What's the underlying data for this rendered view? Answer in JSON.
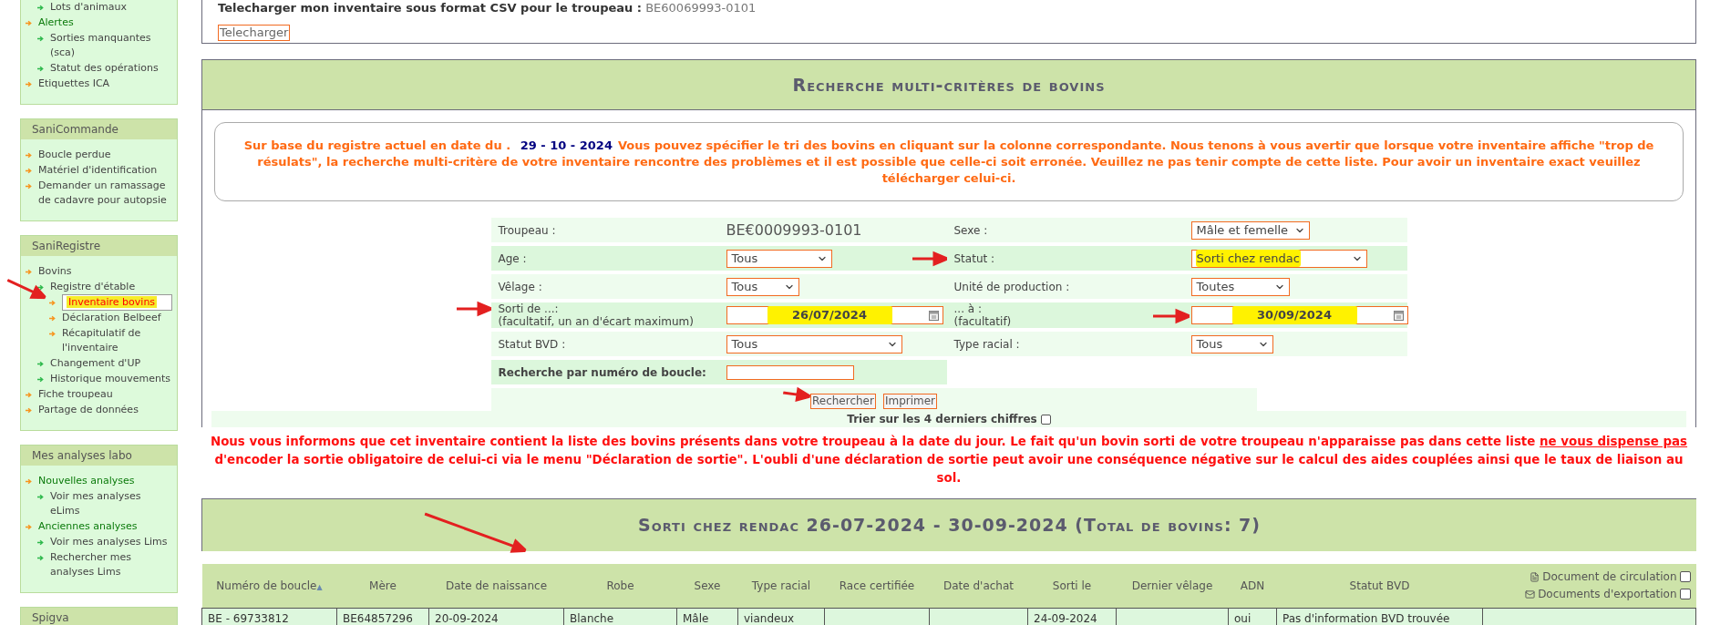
{
  "sidebar": {
    "sections": [
      {
        "items_continued": [
          {
            "label": "Lots d'animaux",
            "selected": false
          }
        ],
        "items": [
          {
            "label": "Alertes",
            "kind": "group",
            "selected": false,
            "children": [
              {
                "label": "Sorties manquantes (sca)",
                "selected": false
              },
              {
                "label": "Statut des opérations",
                "selected": false
              }
            ]
          },
          {
            "label": "Etiquettes ICA",
            "selected": false
          }
        ]
      },
      {
        "title": "SaniCommande",
        "items": [
          {
            "label": "Boucle perdue",
            "selected": false
          },
          {
            "label": "Matériel d'identification",
            "selected": false
          },
          {
            "label": "Demander un ramassage de cadavre pour autopsie",
            "selected": false
          }
        ]
      },
      {
        "title": "SaniRegistre",
        "items": [
          {
            "label": "Bovins",
            "selected": false,
            "children": [
              {
                "label": "Registre d'étable",
                "selected": false,
                "children": [
                  {
                    "label": "Inventaire bovins",
                    "selected": true
                  },
                  {
                    "label": "Déclaration Belbeef",
                    "selected": false
                  },
                  {
                    "label": "Récapitulatif de l'inventaire",
                    "selected": false
                  }
                ]
              },
              {
                "label": "Changement d'UP",
                "selected": false
              },
              {
                "label": "Historique mouvements",
                "selected": false
              }
            ]
          },
          {
            "label": "Fiche troupeau",
            "selected": false
          },
          {
            "label": "Partage de données",
            "selected": false
          }
        ]
      },
      {
        "title": "Mes analyses labo",
        "items": [
          {
            "label": "Nouvelles analyses",
            "kind": "group",
            "selected": false,
            "children": [
              {
                "label": "Voir mes analyses eLims",
                "selected": false
              }
            ]
          },
          {
            "label": "Anciennes analyses",
            "kind": "group",
            "selected": false,
            "children": [
              {
                "label": "Voir mes analyses Lims",
                "selected": false
              },
              {
                "label": "Rechercher mes analyses Lims",
                "selected": false
              }
            ]
          }
        ]
      },
      {
        "title": "Spigva"
      }
    ]
  },
  "export": {
    "label": "Telecharger mon inventaire sous format CSV pour le troupeau :",
    "herd": "BE60069993-0101",
    "button": "Telecharger"
  },
  "search": {
    "title": "Recherche multi-critères de bovins",
    "notice": {
      "prefix": "Sur base du registre actuel en date du .",
      "date": "29 - 10 - 2024",
      "text": "Vous pouvez spécifier le tri des bovins en cliquant sur la colonne correspondante. Nous tenons à vous avertir que lorsque votre inventaire affiche \"trop de résulats\", la recherche multi-critère de votre inventaire rencontre des problèmes et il est possible que celle-ci soit erronée. Veuillez ne pas tenir compte de cette liste. Pour avoir un inventaire exact veuillez télécharger celui-ci."
    },
    "rows": [
      [
        {
          "label": "Troupeau :",
          "kind": "text",
          "value": "BE€0009993-0101"
        },
        {
          "label": "Sexe :",
          "kind": "select",
          "value": "Mâle et femelle",
          "highlighted": false
        }
      ],
      [
        {
          "label": "Age :",
          "kind": "select",
          "value": "Tous",
          "highlighted": false
        },
        {
          "label": "Statut :",
          "kind": "select",
          "value": "Sorti chez rendac",
          "highlighted": true,
          "label_arrow": true
        }
      ],
      [
        {
          "label": "Vêlage :",
          "kind": "select",
          "value": "Tous",
          "highlighted": false
        },
        {
          "label": "Unité de production :",
          "kind": "select",
          "value": "Toutes",
          "highlighted": false
        }
      ],
      [
        {
          "label": "Sorti de ...:",
          "note": "(facultatif, un an d'écart maximum)",
          "kind": "date",
          "value": "26/07/2024",
          "highlighted": true,
          "label_arrow": true
        },
        {
          "label": "... à :",
          "note": "(facultatif)",
          "kind": "date",
          "value": "30/09/2024",
          "highlighted": true,
          "field_arrow": true
        }
      ],
      [
        {
          "label": "Statut BVD :",
          "kind": "select",
          "value": "Tous",
          "highlighted": false
        },
        {
          "label": "Type racial :",
          "kind": "select",
          "value": "Tous",
          "highlighted": false
        }
      ],
      [
        {
          "label": "Recherche par numéro de boucle:",
          "bold": true,
          "kind": "input"
        }
      ]
    ],
    "buttons": [
      {
        "label": "Rechercher",
        "marked": true
      },
      {
        "label": "Imprimer",
        "marked": false
      }
    ],
    "sort_option": {
      "label": "Trier sur les 4 derniers chiffres",
      "checked": false
    }
  },
  "warning": {
    "before": "Nous vous informons que cet inventaire contient la liste des bovins présents dans votre troupeau à la date du jour. Le fait qu'un bovin sorti de votre troupeau n'apparaisse pas dans cette liste",
    "underlined": "ne vous dispense pas",
    "after": "d'encoder la sortie obligatoire de celui-ci via le menu \"Déclaration de sortie\". L'oubli d'une déclaration de sortie peut avoir une conséquence négative sur le calcul des aides couplées ainsi que le taux de liaison au sol."
  },
  "results": {
    "title": "Sorti chez rendac 26-07-2024 - 30-09-2024 (Total de bovins: 7)",
    "marked": true,
    "columns": [
      {
        "label": "Numéro de boucle",
        "sort": "▲"
      },
      {
        "label": "Mère"
      },
      {
        "label": "Date de naissance"
      },
      {
        "label": "Robe"
      },
      {
        "label": "Sexe"
      },
      {
        "label": "Type racial"
      },
      {
        "label": "Race certifiée"
      },
      {
        "label": "Date d'achat"
      },
      {
        "label": "Sorti le"
      },
      {
        "label": "Dernier vêlage"
      },
      {
        "label": "ADN"
      },
      {
        "label": "Statut BVD"
      }
    ],
    "documents": [
      {
        "kind": "pdf",
        "label": "Document de circulation",
        "checked": false
      },
      {
        "kind": "mail",
        "label": "Documents d'exportation",
        "checked": false
      }
    ],
    "rows": [
      [
        "BE - 69733812",
        "BE64857296",
        "20-09-2024",
        "Blanche",
        "Mâle",
        "viandeux",
        "",
        "",
        "24-09-2024",
        "",
        "oui",
        "Pas d'information BVD trouvée"
      ]
    ]
  }
}
